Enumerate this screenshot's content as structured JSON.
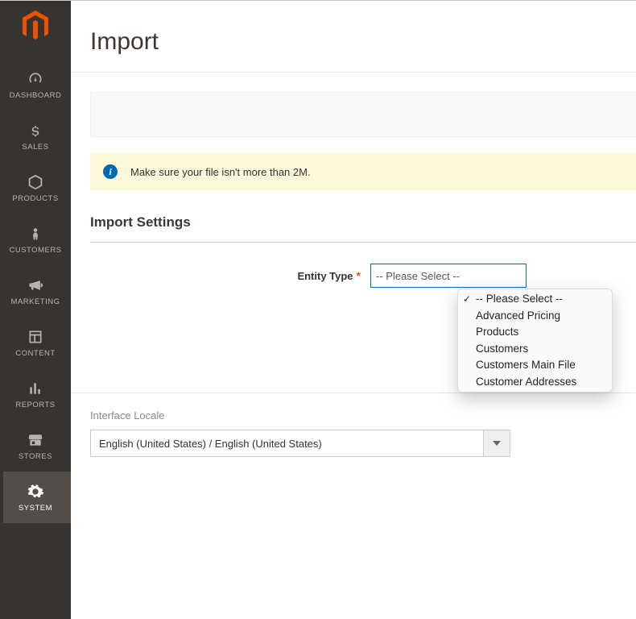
{
  "sidebar": {
    "items": [
      {
        "label": "DASHBOARD",
        "name": "nav-dashboard",
        "icon": "gauge-icon"
      },
      {
        "label": "SALES",
        "name": "nav-sales",
        "icon": "dollar-icon"
      },
      {
        "label": "PRODUCTS",
        "name": "nav-products",
        "icon": "cube-icon"
      },
      {
        "label": "CUSTOMERS",
        "name": "nav-customers",
        "icon": "person-icon"
      },
      {
        "label": "MARKETING",
        "name": "nav-marketing",
        "icon": "megaphone-icon"
      },
      {
        "label": "CONTENT",
        "name": "nav-content",
        "icon": "layout-icon"
      },
      {
        "label": "REPORTS",
        "name": "nav-reports",
        "icon": "bars-icon"
      },
      {
        "label": "STORES",
        "name": "nav-stores",
        "icon": "storefront-icon"
      },
      {
        "label": "SYSTEM",
        "name": "nav-system",
        "icon": "gear-icon"
      }
    ],
    "active_index": 8
  },
  "page": {
    "title": "Import",
    "notice_text": "Make sure your file isn't more than 2M.",
    "section_title": "Import Settings",
    "entity_type_label": "Entity Type",
    "entity_type_selected": "-- Please Select --",
    "entity_type_options": [
      "-- Please Select --",
      "Advanced Pricing",
      "Products",
      "Customers",
      "Customers Main File",
      "Customer Addresses"
    ]
  },
  "footer": {
    "locale_label": "Interface Locale",
    "locale_value": "English (United States) / English (United States)"
  }
}
